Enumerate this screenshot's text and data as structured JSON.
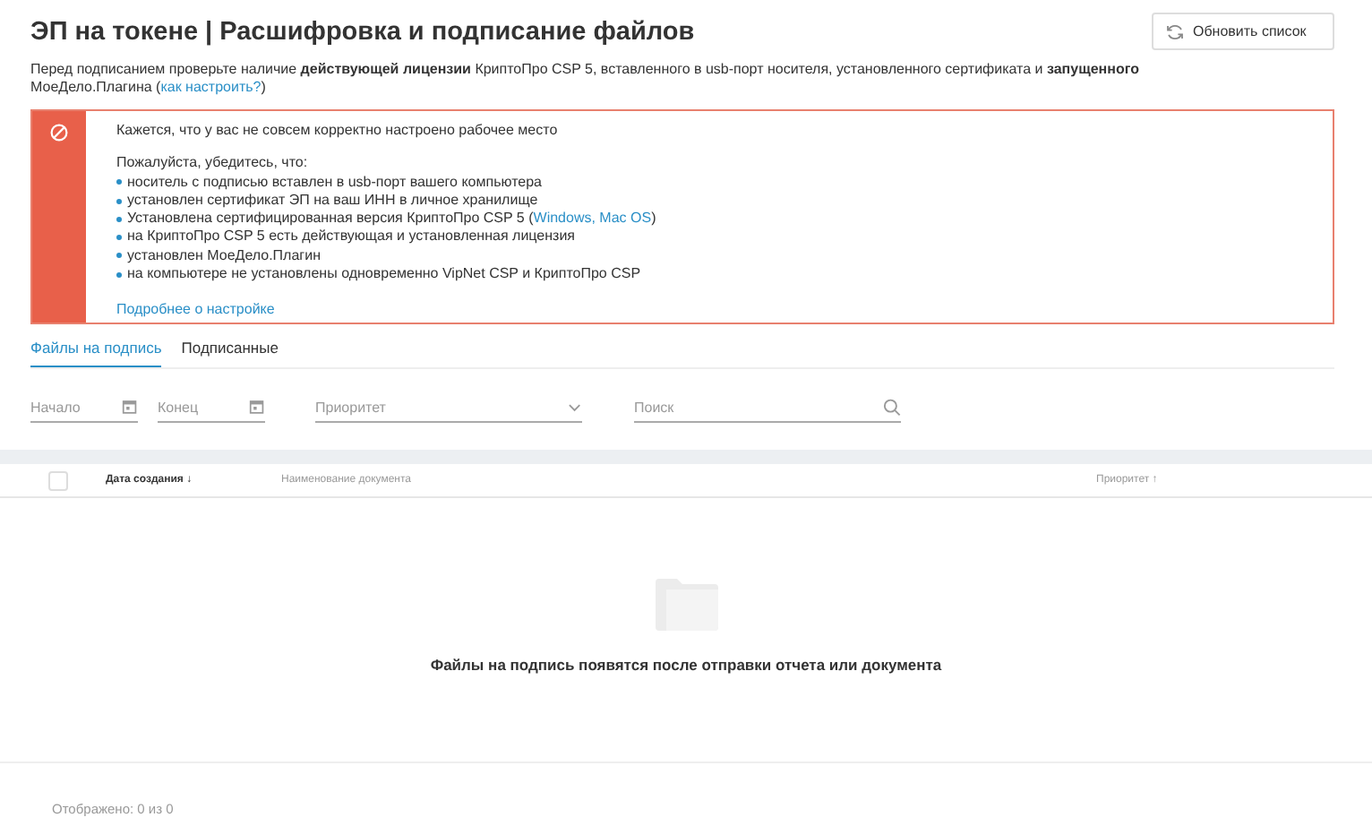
{
  "page": {
    "title": "ЭП на токене | Расшифровка и подписание файлов",
    "refresh_button": "Обновить список"
  },
  "intro": [
    {
      "text": "Перед подписанием проверьте наличие **действующей лицензии** КриптоПро CSP 5, вставленного в usb-порт носителя, установленного сертификата и **запущенного** МоеДело.Плагина ("
    },
    {
      "link": "как настроить?"
    },
    {
      "text": ")"
    }
  ],
  "alert": {
    "title": "Кажется, что у вас не совсем корректно настроено рабочее место",
    "lead": "Пожалуйста, убедитесь, что:",
    "items": [
      [
        {
          "text": "носитель с подписью вставлен в usb-порт вашего компьютера"
        }
      ],
      [
        {
          "text": "установлен сертификат ЭП на ваш ИНН в личное хранилище"
        }
      ],
      [
        {
          "text": "Установлена сертифицированная версия КриптоПро CSP 5 ("
        },
        {
          "link": "Windows, Mac OS"
        },
        {
          "text": ")"
        }
      ],
      [
        {
          "text": "на КриптоПро CSP 5 есть действующая и установленная лицензия"
        }
      ],
      [
        {
          "text": "установлен МоеДело.Плагин"
        }
      ],
      [
        {
          "text": "на компьютере не установлены одновременно VipNet CSP и КриптоПро CSP"
        }
      ]
    ],
    "more_link": "Подробнее о настройке"
  },
  "tabs": [
    {
      "label": "Файлы на подпись",
      "selected": true
    },
    {
      "label": "Подписанные",
      "selected": false
    }
  ],
  "filters": [
    {
      "kind": "date",
      "placeholder": "Начало"
    },
    {
      "kind": "date",
      "placeholder": "Конец"
    },
    {
      "kind": "select",
      "placeholder": "Приоритет"
    },
    {
      "kind": "search",
      "placeholder": "Поиск"
    }
  ],
  "table": {
    "select_all": {
      "checked": false
    },
    "columns": [
      {
        "label": "Дата создания ↓",
        "active": true
      },
      {
        "label": "Наименование документа",
        "active": false
      },
      {
        "label": "Приоритет ↑",
        "active": false
      }
    ]
  },
  "empty_state": {
    "message": "Файлы на подпись появятся после отправки отчета или документа"
  },
  "footer": {
    "shown": "Отображено: 0 из 0"
  }
}
